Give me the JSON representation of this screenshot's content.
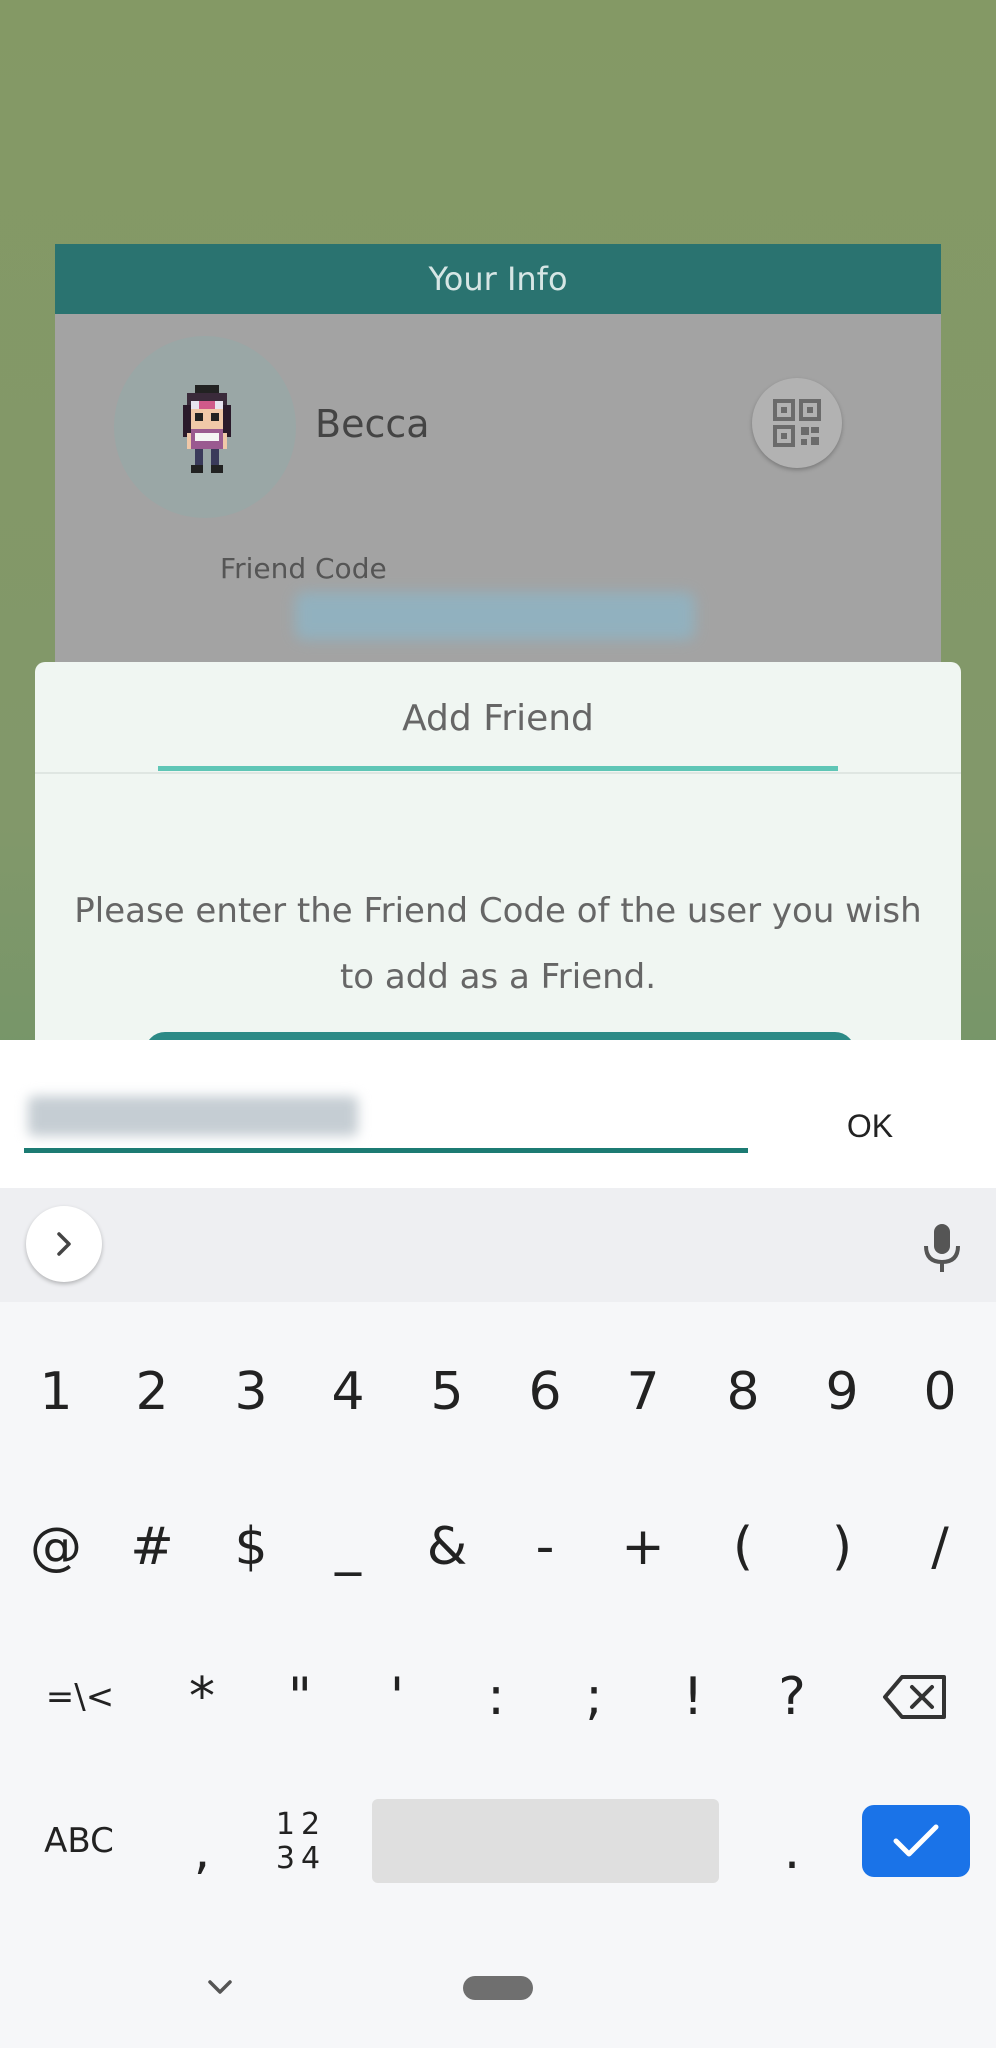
{
  "info_card": {
    "header": "Your Info",
    "name": "Becca",
    "friend_code_label": "Friend Code"
  },
  "dialog": {
    "title": "Add Friend",
    "message": "Please enter the Friend Code of the user you wish to add as a Friend."
  },
  "input_bar": {
    "ok_label": "OK"
  },
  "keyboard": {
    "row1": [
      "1",
      "2",
      "3",
      "4",
      "5",
      "6",
      "7",
      "8",
      "9",
      "0"
    ],
    "row2": [
      "@",
      "#",
      "$",
      "_",
      "&",
      "-",
      "+",
      "(",
      ")",
      "/"
    ],
    "row3": [
      "=\\<",
      "*",
      "\"",
      "'",
      ":",
      ";",
      "!",
      "?"
    ],
    "abc_label": "ABC",
    "comma": ",",
    "numpad_top": "12",
    "numpad_bottom": "34",
    "period": ".",
    "icons": {
      "expand": "chevron-right-icon",
      "mic": "microphone-icon",
      "backspace": "backspace-icon",
      "enter": "checkmark-icon",
      "nav_back": "chevron-down-icon"
    }
  },
  "colors": {
    "header_teal": "#2a7370",
    "accent_mint": "#5fc6b6",
    "input_underline": "#1c7b73",
    "enter_blue": "#1a73e8"
  }
}
